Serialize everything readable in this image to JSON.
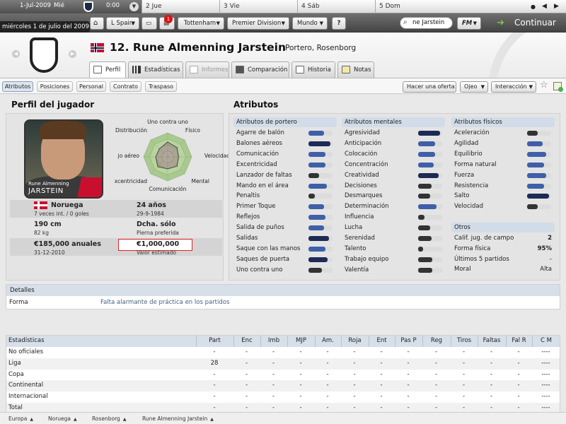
{
  "datebar": {
    "current_date": "1-Jul-2009",
    "current_day": "Mié",
    "time": "0:00",
    "days": [
      {
        "num": "2",
        "label": "Jue"
      },
      {
        "num": "3",
        "label": "Vie"
      },
      {
        "num": "4",
        "label": "Sáb"
      },
      {
        "num": "5",
        "label": "Dom"
      }
    ]
  },
  "toolbar": {
    "date_tooltip": "miércoles 1 de julio del 2009",
    "league_button": "L Spain",
    "badge_count": "1",
    "team_button": "Tottenham",
    "competition_button": "Premier Division",
    "world_button": "Mundo",
    "help_label": "?",
    "search_value": "ne Jarstein",
    "fm_label": "FM",
    "continue_label": "Continuar"
  },
  "header": {
    "player_title": "12. Rune Almenning Jarstein",
    "player_role": "Portero, Rosenborg"
  },
  "tabs": [
    {
      "label": "Perfil",
      "state": "active"
    },
    {
      "label": "Estadísticas",
      "state": "normal"
    },
    {
      "label": "Informes",
      "state": "disabled"
    },
    {
      "label": "Comparación",
      "state": "normal"
    },
    {
      "label": "Historia",
      "state": "normal"
    },
    {
      "label": "Notas",
      "state": "normal"
    }
  ],
  "subtabs": [
    "Atributos",
    "Posiciones",
    "Personal",
    "Contrato",
    "Traspaso"
  ],
  "actions": {
    "offer": "Hacer una oferta",
    "scout": "Ojeo",
    "interaction": "Interacción"
  },
  "profile": {
    "section_title": "Perfil del jugador",
    "photo_caption_small": "Rune  Almenning",
    "photo_caption_big": "JARSTEIN",
    "radar_labels": [
      "Uno contra uno",
      "Físico",
      "Velocidad",
      "Mental",
      "Comunicación",
      "Excentricidad",
      "Juego aéreo",
      "Distribución"
    ],
    "radar_labels_shown": [
      "Uno contra uno",
      "Físico",
      "Velocidad",
      "Mental",
      "Comunicación",
      "xcentricidad",
      "jo aéreo",
      "Distribución"
    ],
    "radar_values": [
      0.62,
      0.55,
      0.45,
      0.55,
      0.5,
      0.58,
      0.5,
      0.48
    ],
    "nation": "Noruega",
    "caps": "7 veces int. / 0 goles",
    "age": "24 años",
    "dob": "29-9-1984",
    "height": "190 cm",
    "weight": "82 kg",
    "foot": "Dcha. sólo",
    "foot_label": "Pierna preferida",
    "wage": "€185,000 anuales",
    "contract_end": "31-12-2010",
    "value": "€1,000,000",
    "value_label": "Valor estimado"
  },
  "attributes": {
    "section_title": "Atributos",
    "goalkeeper": {
      "title": "Atributos de portero",
      "items": [
        {
          "name": "Agarre de balón",
          "value": 13,
          "color": "#3f5fa8"
        },
        {
          "name": "Balones aéreos",
          "value": 18,
          "color": "#1c2a55"
        },
        {
          "name": "Comunicación",
          "value": 14,
          "color": "#3f5fa8"
        },
        {
          "name": "Excentricidad",
          "value": 14,
          "color": "#3f5fa8"
        },
        {
          "name": "Lanzador de faltas",
          "value": 9,
          "color": "#333333"
        },
        {
          "name": "Mando en el área",
          "value": 15,
          "color": "#3f5fa8"
        },
        {
          "name": "Penaltis",
          "value": 5,
          "color": "#333333"
        },
        {
          "name": "Primer Toque",
          "value": 13,
          "color": "#3f5fa8"
        },
        {
          "name": "Reflejos",
          "value": 14,
          "color": "#3f5fa8"
        },
        {
          "name": "Salida de puños",
          "value": 13,
          "color": "#3f5fa8"
        },
        {
          "name": "Salidas",
          "value": 17,
          "color": "#1c2a55"
        },
        {
          "name": "Saque con las manos",
          "value": 14,
          "color": "#3f5fa8"
        },
        {
          "name": "Saques de puerta",
          "value": 16,
          "color": "#1c2a55"
        },
        {
          "name": "Uno contra uno",
          "value": 11,
          "color": "#333333"
        }
      ]
    },
    "mental": {
      "title": "Atributos mentales",
      "items": [
        {
          "name": "Agresividad",
          "value": 18,
          "color": "#1c2a55"
        },
        {
          "name": "Anticipación",
          "value": 14,
          "color": "#3f5fa8"
        },
        {
          "name": "Colocación",
          "value": 14,
          "color": "#3f5fa8"
        },
        {
          "name": "Concentración",
          "value": 13,
          "color": "#3f5fa8"
        },
        {
          "name": "Creatividad",
          "value": 17,
          "color": "#1c2a55"
        },
        {
          "name": "Decisiones",
          "value": 11,
          "color": "#333333"
        },
        {
          "name": "Desmarques",
          "value": 10,
          "color": "#333333"
        },
        {
          "name": "Determinación",
          "value": 15,
          "color": "#3f5fa8"
        },
        {
          "name": "Influencia",
          "value": 5,
          "color": "#333333"
        },
        {
          "name": "Lucha",
          "value": 10,
          "color": "#333333"
        },
        {
          "name": "Serenidad",
          "value": 11,
          "color": "#333333"
        },
        {
          "name": "Talento",
          "value": 4,
          "color": "#333333"
        },
        {
          "name": "Trabajo equipo",
          "value": 12,
          "color": "#333333"
        },
        {
          "name": "Valentía",
          "value": 12,
          "color": "#333333"
        }
      ]
    },
    "physical": {
      "title": "Atributos físicos",
      "items": [
        {
          "name": "Aceleración",
          "value": 9,
          "color": "#333333"
        },
        {
          "name": "Agilidad",
          "value": 13,
          "color": "#3f5fa8"
        },
        {
          "name": "Equilibrio",
          "value": 16,
          "color": "#3f5fa8"
        },
        {
          "name": "Forma natural",
          "value": 14,
          "color": "#3f5fa8"
        },
        {
          "name": "Fuerza",
          "value": 16,
          "color": "#3f5fa8"
        },
        {
          "name": "Resistencia",
          "value": 14,
          "color": "#3f5fa8"
        },
        {
          "name": "Salto",
          "value": 18,
          "color": "#1c2a55"
        },
        {
          "name": "Velocidad",
          "value": 9,
          "color": "#333333"
        }
      ]
    },
    "other": {
      "title": "Otros",
      "items": [
        {
          "name": "Calif. jug. de campo",
          "value": "2",
          "bold": true
        },
        {
          "name": "Forma física",
          "value": "95%",
          "bold": true
        },
        {
          "name": "Últimos 5 partidos",
          "value": "-",
          "bold": false
        },
        {
          "name": "Moral",
          "value": "Alta",
          "bold": false
        }
      ]
    }
  },
  "details": {
    "title": "Detalles",
    "label": "Forma",
    "value": "Falta alarmante de práctica en los partidos"
  },
  "stats": {
    "header": "Estadísticas",
    "columns": [
      "Part",
      "Enc",
      "Imb",
      "MJP",
      "Am.",
      "Roja",
      "Ent",
      "Pas P",
      "Reg",
      "Tiros",
      "Faltas",
      "Fal R",
      "C M"
    ],
    "rows": [
      {
        "label": "No oficiales",
        "cells": [
          "-",
          "-",
          "-",
          "-",
          "-",
          "-",
          "-",
          "-",
          "-",
          "-",
          "-",
          "-",
          "----"
        ]
      },
      {
        "label": "Liga",
        "cells": [
          "28",
          "-",
          "-",
          "-",
          "-",
          "-",
          "-",
          "-",
          "-",
          "-",
          "-",
          "-",
          "----"
        ]
      },
      {
        "label": "Copa",
        "cells": [
          "-",
          "-",
          "-",
          "-",
          "-",
          "-",
          "-",
          "-",
          "-",
          "-",
          "-",
          "-",
          "----"
        ]
      },
      {
        "label": "Continental",
        "cells": [
          "-",
          "-",
          "-",
          "-",
          "-",
          "-",
          "-",
          "-",
          "-",
          "-",
          "-",
          "-",
          "----"
        ]
      },
      {
        "label": "Internacional",
        "cells": [
          "-",
          "-",
          "-",
          "-",
          "-",
          "-",
          "-",
          "-",
          "-",
          "-",
          "-",
          "-",
          "----"
        ]
      },
      {
        "label": "Total",
        "cells": [
          "-",
          "-",
          "-",
          "-",
          "-",
          "-",
          "-",
          "-",
          "-",
          "-",
          "-",
          "-",
          "----"
        ]
      }
    ]
  },
  "breadcrumbs": [
    "Europa",
    "Noruega",
    "Rosenborg",
    "Rune Almenning Jarstein"
  ]
}
